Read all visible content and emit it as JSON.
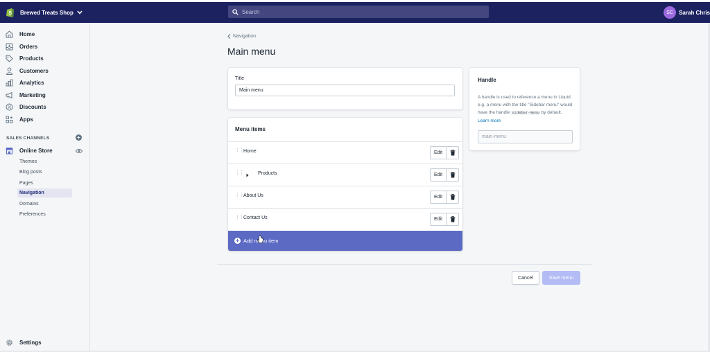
{
  "topbar": {
    "store_name": "Brewed Treats Shop",
    "search_placeholder": "Search",
    "user_initials": "SC",
    "user_name": "Sarah Chris"
  },
  "sidebar": {
    "items": [
      {
        "label": "Home",
        "icon": "home-icon"
      },
      {
        "label": "Orders",
        "icon": "orders-icon"
      },
      {
        "label": "Products",
        "icon": "tag-icon"
      },
      {
        "label": "Customers",
        "icon": "person-icon"
      },
      {
        "label": "Analytics",
        "icon": "bar-chart-icon"
      },
      {
        "label": "Marketing",
        "icon": "megaphone-icon"
      },
      {
        "label": "Discounts",
        "icon": "discount-icon"
      },
      {
        "label": "Apps",
        "icon": "apps-icon"
      }
    ],
    "sales_channels_label": "SALES CHANNELS",
    "online_store_label": "Online Store",
    "sub_items": [
      "Themes",
      "Blog posts",
      "Pages",
      "Navigation",
      "Domains",
      "Preferences"
    ],
    "active_sub_item": "Navigation",
    "settings_label": "Settings"
  },
  "main": {
    "breadcrumb": "Navigation",
    "page_title": "Main menu",
    "title_card": {
      "label": "Title",
      "value": "Main menu"
    },
    "menu_items_card": {
      "heading": "Menu items",
      "items": [
        {
          "label": "Home",
          "has_children": false
        },
        {
          "label": "Products",
          "has_children": true
        },
        {
          "label": "About Us",
          "has_children": false
        },
        {
          "label": "Contact Us",
          "has_children": false
        }
      ],
      "edit_label": "Edit",
      "add_label": "Add menu item"
    },
    "handle_card": {
      "heading": "Handle",
      "desc_part1": "A handle is used to reference a menu in Liquid. e.g. a menu with the title \"Sidebar menu\" would have the handle",
      "desc_code": "sidebar-menu",
      "desc_part2": "by default.",
      "learn_more": "Learn more",
      "placeholder": "main-menu"
    },
    "actions": {
      "cancel": "Cancel",
      "save": "Save menu"
    }
  },
  "colors": {
    "topbar": "#1c2260",
    "accent": "#5c6ac4",
    "save_disabled": "#b3bcf5",
    "link": "#006fbb"
  }
}
